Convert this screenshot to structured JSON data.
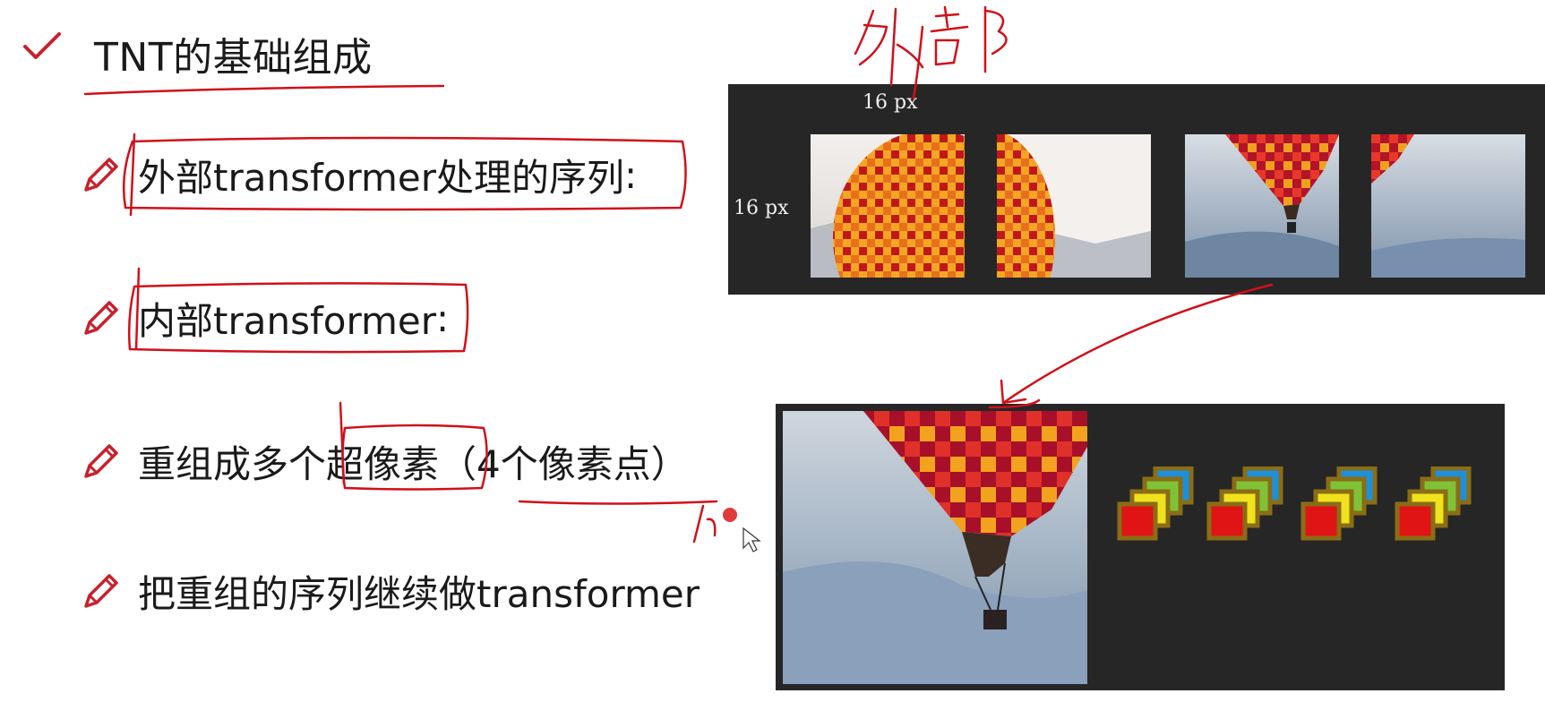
{
  "slide": {
    "title": "TNT的基础组成",
    "bullets": [
      {
        "text": "外部transformer处理的序列",
        "suffix": ":"
      },
      {
        "text": "内部transformer",
        "suffix": ":"
      },
      {
        "text": "重组成多个超像素（4个像素点）",
        "suffix": ""
      },
      {
        "text": "把重组的序列继续做transformer",
        "suffix": ""
      }
    ]
  },
  "figure": {
    "top_label": "16 px",
    "side_label": "16 px"
  },
  "colors": {
    "annotation_red": "#d0101a",
    "dark_panel": "#262626"
  },
  "icons": [
    "check-icon",
    "pencil-icon",
    "cursor-icon"
  ]
}
